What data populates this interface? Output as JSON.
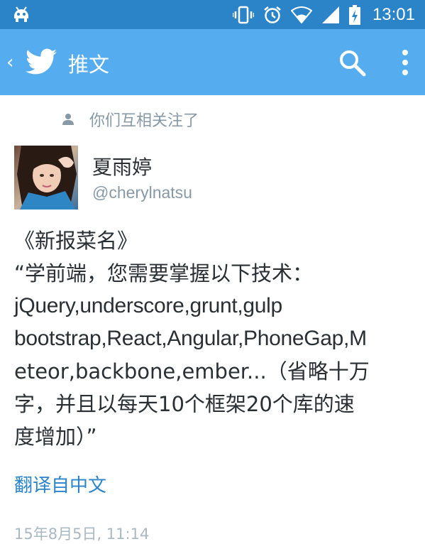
{
  "status_bar": {
    "time": "13:01",
    "icons": [
      "android-icon",
      "vibrate-icon",
      "alarm-icon",
      "wifi-icon",
      "signal-icon",
      "battery-charging-icon"
    ]
  },
  "app_bar": {
    "title": "推文",
    "back_icon": "chevron-left-icon",
    "logo_icon": "twitter-bird-icon",
    "search_icon": "search-icon",
    "menu_icon": "more-vert-icon",
    "color": "#55acee",
    "status_color": "#2b84c8"
  },
  "tweet": {
    "follow_status": "你们互相关注了",
    "follow_icon": "person-icon",
    "author_name": "夏雨婷",
    "author_handle": "@cherylnatsu",
    "lines": [
      "《新报菜名》",
      "“学前端，您需要掌握以下技术：",
      "jQuery,underscore,grunt,gulp",
      "bootstrap,React,Angular,PhoneGap,M",
      "eteor,backbone,ember...（省略十万",
      "字，并且以每天10个框架20个库的速",
      "度增加）”"
    ],
    "translate_label": "翻译自中文",
    "timestamp": "15年8月5日, 11:14",
    "link_color": "#2b84c8"
  }
}
